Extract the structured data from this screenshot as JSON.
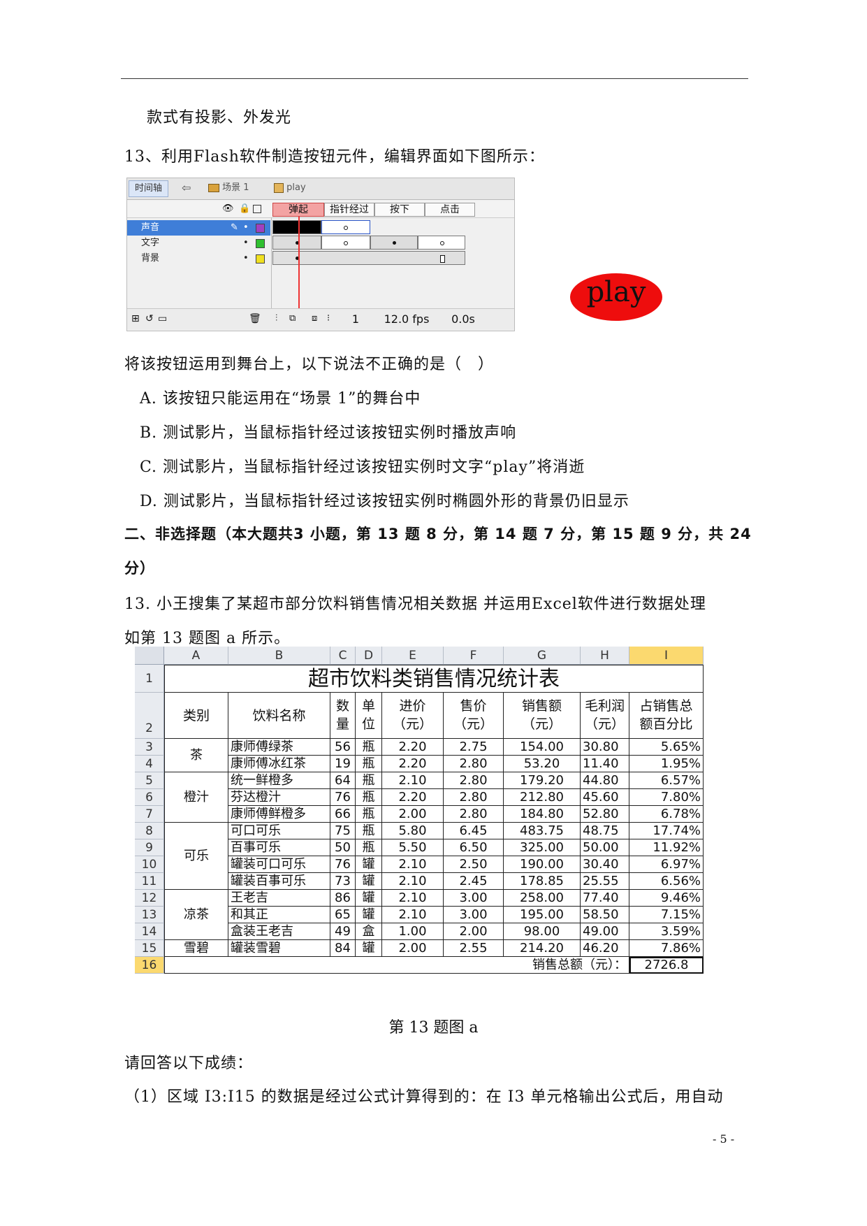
{
  "header_line": "",
  "p1": "款式有投影、外发光",
  "q13_stem": "13、利用Flash软件制造按钮元件，编辑界面如下图所示：",
  "flash": {
    "timeline_tab": "时间轴",
    "back_arrow": "⇦",
    "scene": "场景 1",
    "symbol": "play",
    "states": [
      "弹起",
      "指针经过",
      "按下",
      "点击"
    ],
    "layers": [
      {
        "name": "声音",
        "color": "#a040c0"
      },
      {
        "name": "文字",
        "color": "#30c030"
      },
      {
        "name": "背景",
        "color": "#f0e020"
      }
    ],
    "frame_number": "1",
    "fps": "12.0 fps",
    "time": "0.0s"
  },
  "play_button_text": "play",
  "q_lead": "将该按钮运用到舞台上，以下说法不正确的是（　）",
  "options": [
    "A. 该按钮只能运用在“场景 1”的舞台中",
    "B. 测试影片，当鼠标指针经过该按钮实例时播放声响",
    "C. 测试影片，当鼠标指针经过该按钮实例时文字“play”将消逝",
    "D. 测试影片，当鼠标指针经过该按钮实例时椭圆外形的背景仍旧显示"
  ],
  "section2_line1": "二、非选择题（本大题共3 小题，第 13 题 8 分，第 14 题 7 分，第 15 题 9 分，共 24",
  "section2_line2": "分）",
  "q13b_line1": "13. 小王搜集了某超市部分饮料销售情况相关数据 并运用Excel软件进行数据处理",
  "q13b_line2": "如第 13 题图 a 所示。",
  "excel": {
    "col_letters": [
      "A",
      "B",
      "C",
      "D",
      "E",
      "F",
      "G",
      "H",
      "I"
    ],
    "row_numbers": [
      "1",
      "2",
      "3",
      "4",
      "5",
      "6",
      "7",
      "8",
      "9",
      "10",
      "11",
      "12",
      "13",
      "14",
      "15",
      "16"
    ],
    "title": "超市饮料类销售情况统计表",
    "headers": [
      "类别",
      "饮料名称",
      "数量",
      "单位",
      "进价（元）",
      "售价（元）",
      "销售额（元）",
      "毛利润（元）",
      "占销售总额百分比"
    ],
    "header_lines": [
      [
        "类别"
      ],
      [
        "饮料名称"
      ],
      [
        "数",
        "量"
      ],
      [
        "单",
        "位"
      ],
      [
        "进价",
        "（元）"
      ],
      [
        "售价",
        "（元）"
      ],
      [
        "销售额",
        "（元）"
      ],
      [
        "毛利润",
        "（元）"
      ],
      [
        "占销售总",
        "额百分比"
      ]
    ],
    "categories": [
      {
        "name": "茶",
        "rows": 2
      },
      {
        "name": "橙汁",
        "rows": 3
      },
      {
        "name": "可乐",
        "rows": 4
      },
      {
        "name": "凉茶",
        "rows": 3
      },
      {
        "name": "雪碧",
        "rows": 1
      }
    ],
    "rows": [
      [
        "康师傅绿茶",
        "56",
        "瓶",
        "2.20",
        "2.75",
        "154.00",
        "30.80",
        "5.65%"
      ],
      [
        "康师傅冰红茶",
        "19",
        "瓶",
        "2.20",
        "2.80",
        "53.20",
        "11.40",
        "1.95%"
      ],
      [
        "统一鲜橙多",
        "64",
        "瓶",
        "2.10",
        "2.80",
        "179.20",
        "44.80",
        "6.57%"
      ],
      [
        "芬达橙汁",
        "76",
        "瓶",
        "2.20",
        "2.80",
        "212.80",
        "45.60",
        "7.80%"
      ],
      [
        "康师傅鲜橙多",
        "66",
        "瓶",
        "2.00",
        "2.80",
        "184.80",
        "52.80",
        "6.78%"
      ],
      [
        "可口可乐",
        "75",
        "瓶",
        "5.80",
        "6.45",
        "483.75",
        "48.75",
        "17.74%"
      ],
      [
        "百事可乐",
        "50",
        "瓶",
        "5.50",
        "6.50",
        "325.00",
        "50.00",
        "11.92%"
      ],
      [
        "罐装可口可乐",
        "76",
        "罐",
        "2.10",
        "2.50",
        "190.00",
        "30.40",
        "6.97%"
      ],
      [
        "罐装百事可乐",
        "73",
        "罐",
        "2.10",
        "2.45",
        "178.85",
        "25.55",
        "6.56%"
      ],
      [
        "王老吉",
        "86",
        "罐",
        "2.10",
        "3.00",
        "258.00",
        "77.40",
        "9.46%"
      ],
      [
        "和其正",
        "65",
        "罐",
        "2.10",
        "3.00",
        "195.00",
        "58.50",
        "7.15%"
      ],
      [
        "盒装王老吉",
        "49",
        "盒",
        "1.00",
        "2.00",
        "98.00",
        "49.00",
        "3.59%"
      ],
      [
        "罐装雪碧",
        "84",
        "罐",
        "2.00",
        "2.55",
        "214.20",
        "46.20",
        "7.86%"
      ]
    ],
    "total_label": "销售总额（元）：",
    "total_value": "2726.8"
  },
  "figure_caption": "第 13 题图 a",
  "answer_lead": "请回答以下成绩：",
  "q1_text": "（1）区域 I3:I15 的数据是经过公式计算得到的：在 I3 单元格输出公式后，用自动",
  "page_number": "- 5 -"
}
